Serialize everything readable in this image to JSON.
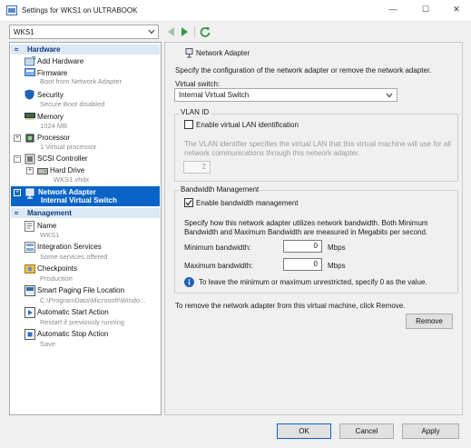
{
  "window": {
    "title": "Settings for WKS1 on ULTRABOOK",
    "minimize": "—",
    "maximize": "☐",
    "close": "✕"
  },
  "toolbar": {
    "vm_selected": "WKS1"
  },
  "hardware": {
    "header": "Hardware",
    "add_hardware": "Add Hardware",
    "firmware": {
      "label": "Firmware",
      "sub": "Boot from Network Adapter"
    },
    "security": {
      "label": "Security",
      "sub": "Secure Boot disabled"
    },
    "memory": {
      "label": "Memory",
      "sub": "1024 MB"
    },
    "processor": {
      "label": "Processor",
      "sub": "1 Virtual processor"
    },
    "scsi": {
      "label": "SCSI Controller"
    },
    "hard_drive": {
      "label": "Hard Drive",
      "sub": "WKS1.vhdx"
    },
    "network_adapter": {
      "label": "Network Adapter",
      "sub": "Internal Virtual Switch"
    }
  },
  "management": {
    "header": "Management",
    "name": {
      "label": "Name",
      "sub": "WKS1"
    },
    "integration": {
      "label": "Integration Services",
      "sub": "Some services offered"
    },
    "checkpoints": {
      "label": "Checkpoints",
      "sub": "Production"
    },
    "paging": {
      "label": "Smart Paging File Location",
      "sub": "C:\\ProgramData\\Microsoft\\Windo..."
    },
    "auto_start": {
      "label": "Automatic Start Action",
      "sub": "Restart if previously running"
    },
    "auto_stop": {
      "label": "Automatic Stop Action",
      "sub": "Save"
    }
  },
  "panel": {
    "title": "Network Adapter",
    "description": "Specify the configuration of the network adapter or remove the network adapter.",
    "switch_label": "Virtual switch:",
    "switch_value": "Internal Virtual Switch",
    "vlan": {
      "group": "VLAN ID",
      "enable_label": "Enable virtual LAN identification",
      "enabled": false,
      "help_line1": "The VLAN identifier specifies the virtual LAN that this virtual machine will use for all",
      "help_line2": "network communications through this network adapter.",
      "value": "2"
    },
    "bandwidth": {
      "group": "Bandwidth Management",
      "enable_label": "Enable bandwidth management",
      "enabled": true,
      "desc_line1": "Specify how this network adapter utilizes network bandwidth. Both Minimum",
      "desc_line2": "Bandwidth and Maximum Bandwidth are measured in Megabits per second.",
      "min_label": "Minimum bandwidth:",
      "min_value": "0",
      "max_label": "Maximum bandwidth:",
      "max_value": "0",
      "unit": "Mbps",
      "info": "To leave the minimum or maximum unrestricted, specify 0 as the value."
    },
    "remove_text": "To remove the network adapter from this virtual machine, click Remove.",
    "remove_button": "Remove"
  },
  "buttons": {
    "ok": "OK",
    "cancel": "Cancel",
    "apply": "Apply"
  },
  "colors": {
    "selection": "#0a64c8",
    "section_header": "#dde8f6",
    "accent_green": "#2e9b3a"
  }
}
